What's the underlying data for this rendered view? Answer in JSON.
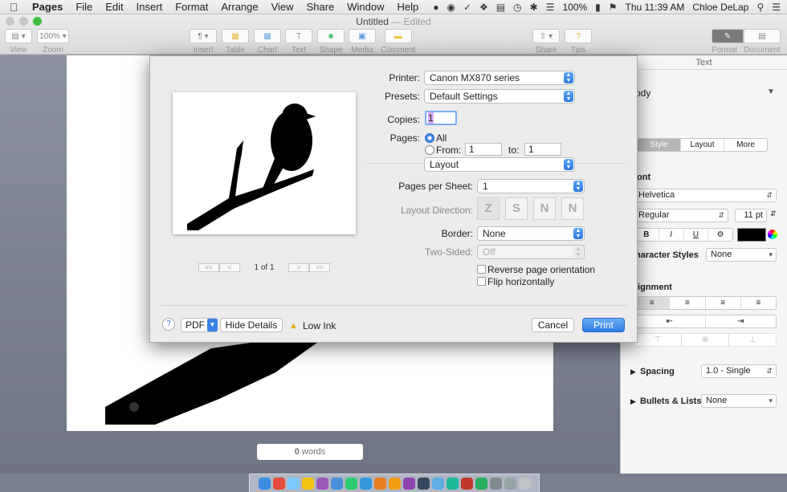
{
  "menubar": {
    "app": "Pages",
    "items": [
      "File",
      "Edit",
      "Insert",
      "Format",
      "Arrange",
      "View",
      "Share",
      "Window",
      "Help"
    ],
    "battery": "100%",
    "clock": "Thu 11:39 AM",
    "user": "Chloe DeLap"
  },
  "window": {
    "title": "Untitled",
    "status": "— Edited",
    "toolbar": {
      "view": "View",
      "zoom_value": "100%",
      "zoom": "Zoom",
      "insert": "Insert",
      "table": "Table",
      "chart": "Chart",
      "text": "Text",
      "shape": "Shape",
      "media": "Media",
      "comment": "Comment",
      "share": "Share",
      "tips": "Tips",
      "format": "Format",
      "document": "Document"
    }
  },
  "canvas": {
    "word_count": "0",
    "word_label": "words"
  },
  "inspector": {
    "header": "Text",
    "style_name": "ody",
    "tabs": [
      "Style",
      "Layout",
      "More"
    ],
    "font_label": "ont",
    "font_family": "Helvetica",
    "font_weight": "Regular",
    "font_size": "11 pt",
    "bold": "B",
    "italic": "I",
    "underline": "U",
    "char_styles_label": "haracter Styles",
    "char_styles_value": "None",
    "alignment_label": "lignment",
    "spacing_label": "Spacing",
    "spacing_value": "1.0 - Single",
    "bullets_label": "Bullets & Lists",
    "bullets_value": "None"
  },
  "dialog": {
    "printer_label": "Printer:",
    "printer_value": "Canon MX870 series",
    "presets_label": "Presets:",
    "presets_value": "Default Settings",
    "copies_label": "Copies:",
    "copies_value": "1",
    "pages_label": "Pages:",
    "pages_all": "All",
    "pages_from": "From:",
    "from_value": "1",
    "to_label": "to:",
    "to_value": "1",
    "section_value": "Layout",
    "pps_label": "Pages per Sheet:",
    "pps_value": "1",
    "direction_label": "Layout Direction:",
    "border_label": "Border:",
    "border_value": "None",
    "twosided_label": "Two-Sided:",
    "twosided_value": "Off",
    "reverse_label": "Reverse page orientation",
    "flip_label": "Flip horizontally",
    "page_indicator": "1 of 1",
    "help": "?",
    "pdf": "PDF",
    "hide_details": "Hide Details",
    "low_ink": "Low Ink",
    "cancel": "Cancel",
    "print": "Print"
  }
}
